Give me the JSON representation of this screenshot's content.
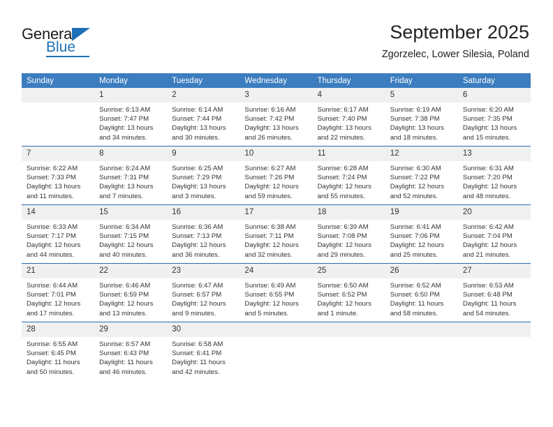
{
  "brand": {
    "name_top": "General",
    "name_bottom": "Blue",
    "accent_color": "#1d70b7"
  },
  "header": {
    "title": "September 2025",
    "subtitle": "Zgorzelec, Lower Silesia, Poland"
  },
  "calendar": {
    "header_bg": "#3b7dbf",
    "daynum_bg": "#f0f0f0",
    "row_border": "#2d6ca8",
    "columns": [
      "Sunday",
      "Monday",
      "Tuesday",
      "Wednesday",
      "Thursday",
      "Friday",
      "Saturday"
    ],
    "weeks": [
      [
        {
          "day": "",
          "info": ""
        },
        {
          "day": "1",
          "info": "Sunrise: 6:13 AM\nSunset: 7:47 PM\nDaylight: 13 hours\nand 34 minutes."
        },
        {
          "day": "2",
          "info": "Sunrise: 6:14 AM\nSunset: 7:44 PM\nDaylight: 13 hours\nand 30 minutes."
        },
        {
          "day": "3",
          "info": "Sunrise: 6:16 AM\nSunset: 7:42 PM\nDaylight: 13 hours\nand 26 minutes."
        },
        {
          "day": "4",
          "info": "Sunrise: 6:17 AM\nSunset: 7:40 PM\nDaylight: 13 hours\nand 22 minutes."
        },
        {
          "day": "5",
          "info": "Sunrise: 6:19 AM\nSunset: 7:38 PM\nDaylight: 13 hours\nand 18 minutes."
        },
        {
          "day": "6",
          "info": "Sunrise: 6:20 AM\nSunset: 7:35 PM\nDaylight: 13 hours\nand 15 minutes."
        }
      ],
      [
        {
          "day": "7",
          "info": "Sunrise: 6:22 AM\nSunset: 7:33 PM\nDaylight: 13 hours\nand 11 minutes."
        },
        {
          "day": "8",
          "info": "Sunrise: 6:24 AM\nSunset: 7:31 PM\nDaylight: 13 hours\nand 7 minutes."
        },
        {
          "day": "9",
          "info": "Sunrise: 6:25 AM\nSunset: 7:29 PM\nDaylight: 13 hours\nand 3 minutes."
        },
        {
          "day": "10",
          "info": "Sunrise: 6:27 AM\nSunset: 7:26 PM\nDaylight: 12 hours\nand 59 minutes."
        },
        {
          "day": "11",
          "info": "Sunrise: 6:28 AM\nSunset: 7:24 PM\nDaylight: 12 hours\nand 55 minutes."
        },
        {
          "day": "12",
          "info": "Sunrise: 6:30 AM\nSunset: 7:22 PM\nDaylight: 12 hours\nand 52 minutes."
        },
        {
          "day": "13",
          "info": "Sunrise: 6:31 AM\nSunset: 7:20 PM\nDaylight: 12 hours\nand 48 minutes."
        }
      ],
      [
        {
          "day": "14",
          "info": "Sunrise: 6:33 AM\nSunset: 7:17 PM\nDaylight: 12 hours\nand 44 minutes."
        },
        {
          "day": "15",
          "info": "Sunrise: 6:34 AM\nSunset: 7:15 PM\nDaylight: 12 hours\nand 40 minutes."
        },
        {
          "day": "16",
          "info": "Sunrise: 6:36 AM\nSunset: 7:13 PM\nDaylight: 12 hours\nand 36 minutes."
        },
        {
          "day": "17",
          "info": "Sunrise: 6:38 AM\nSunset: 7:11 PM\nDaylight: 12 hours\nand 32 minutes."
        },
        {
          "day": "18",
          "info": "Sunrise: 6:39 AM\nSunset: 7:08 PM\nDaylight: 12 hours\nand 29 minutes."
        },
        {
          "day": "19",
          "info": "Sunrise: 6:41 AM\nSunset: 7:06 PM\nDaylight: 12 hours\nand 25 minutes."
        },
        {
          "day": "20",
          "info": "Sunrise: 6:42 AM\nSunset: 7:04 PM\nDaylight: 12 hours\nand 21 minutes."
        }
      ],
      [
        {
          "day": "21",
          "info": "Sunrise: 6:44 AM\nSunset: 7:01 PM\nDaylight: 12 hours\nand 17 minutes."
        },
        {
          "day": "22",
          "info": "Sunrise: 6:46 AM\nSunset: 6:59 PM\nDaylight: 12 hours\nand 13 minutes."
        },
        {
          "day": "23",
          "info": "Sunrise: 6:47 AM\nSunset: 6:57 PM\nDaylight: 12 hours\nand 9 minutes."
        },
        {
          "day": "24",
          "info": "Sunrise: 6:49 AM\nSunset: 6:55 PM\nDaylight: 12 hours\nand 5 minutes."
        },
        {
          "day": "25",
          "info": "Sunrise: 6:50 AM\nSunset: 6:52 PM\nDaylight: 12 hours\nand 1 minute."
        },
        {
          "day": "26",
          "info": "Sunrise: 6:52 AM\nSunset: 6:50 PM\nDaylight: 11 hours\nand 58 minutes."
        },
        {
          "day": "27",
          "info": "Sunrise: 6:53 AM\nSunset: 6:48 PM\nDaylight: 11 hours\nand 54 minutes."
        }
      ],
      [
        {
          "day": "28",
          "info": "Sunrise: 6:55 AM\nSunset: 6:45 PM\nDaylight: 11 hours\nand 50 minutes."
        },
        {
          "day": "29",
          "info": "Sunrise: 6:57 AM\nSunset: 6:43 PM\nDaylight: 11 hours\nand 46 minutes."
        },
        {
          "day": "30",
          "info": "Sunrise: 6:58 AM\nSunset: 6:41 PM\nDaylight: 11 hours\nand 42 minutes."
        },
        {
          "day": "",
          "info": ""
        },
        {
          "day": "",
          "info": ""
        },
        {
          "day": "",
          "info": ""
        },
        {
          "day": "",
          "info": ""
        }
      ]
    ]
  }
}
